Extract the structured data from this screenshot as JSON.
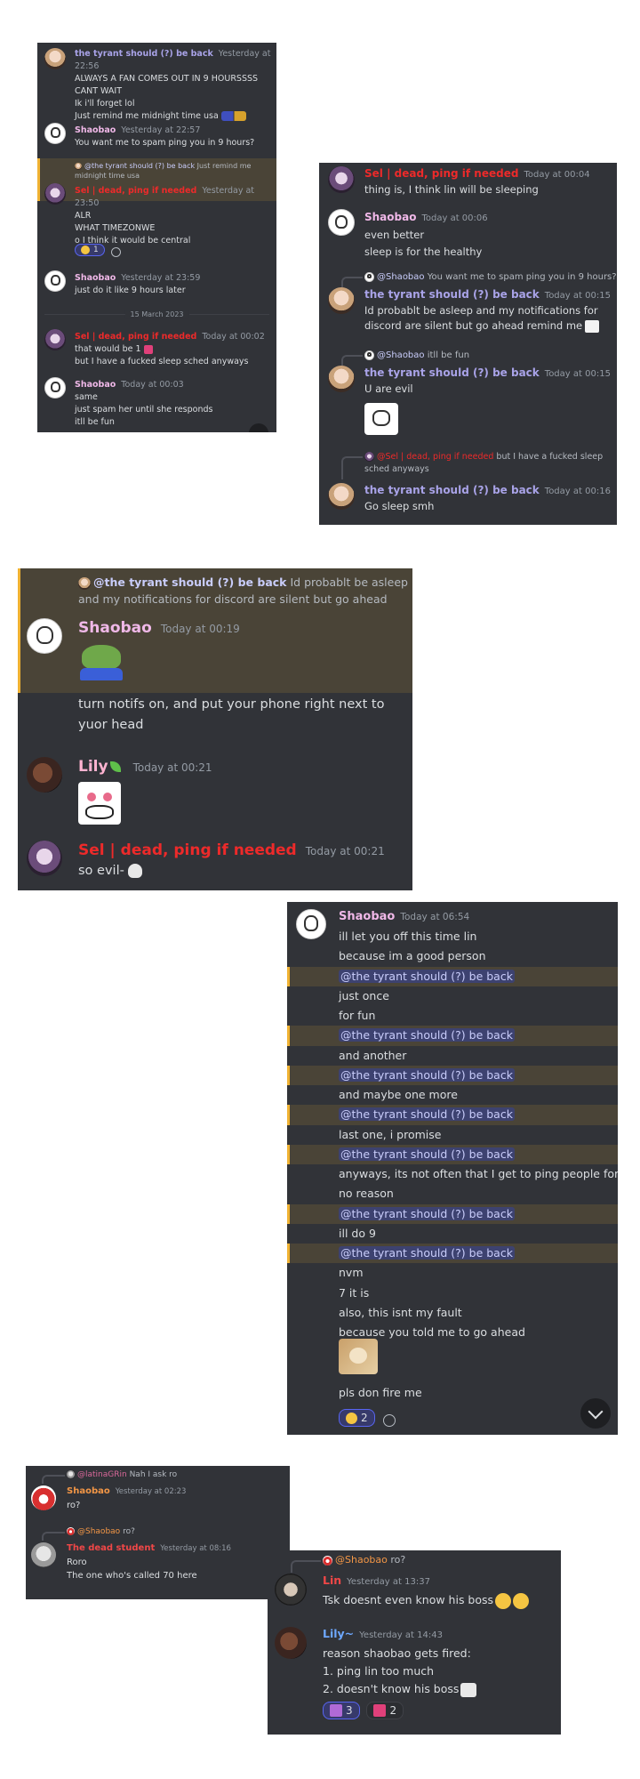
{
  "s1": {
    "m1": {
      "user": "the tyrant should (?) be back",
      "ts": "Yesterday at 22:56",
      "lines": [
        "ALWAYS A FAN COMES OUT IN 9 HOURSSSS",
        "CANT WAIT",
        "Ik i'll forget lol",
        "Just remind me midnight time usa"
      ],
      "emoji": "cheering-emoji"
    },
    "m2": {
      "user": "Shaobao",
      "ts": "Yesterday at 22:57",
      "line": "You want me to spam ping you in 9 hours?"
    },
    "m3": {
      "reply_user": "@the tyrant should (?) be back",
      "reply_text": "Just remind me",
      "reply_text2": "midnight time usa",
      "user": "Sel | dead, ping if needed",
      "ts": "Yesterday at 23:50",
      "lines": [
        "ALR",
        "WHAT TIMEZONWE",
        "o I think it would be central"
      ],
      "reaction_count": "1"
    },
    "m4": {
      "user": "Shaobao",
      "ts": "Yesterday at 23:59",
      "line": "just do it like 9 hours later"
    },
    "divider": "15 March 2023",
    "m5": {
      "user": "Sel | dead, ping if needed",
      "ts": "Today at 00:02",
      "lines": [
        "that would be 1",
        "but I have a fucked sleep sched anyways"
      ]
    },
    "m6": {
      "user": "Shaobao",
      "ts": "Today at 00:03",
      "lines": [
        "same",
        "just spam her until she responds",
        "itll be fun"
      ]
    }
  },
  "s2": {
    "m1": {
      "user": "Sel | dead, ping if needed",
      "ts": "Today at 00:04",
      "line": "thing is, I think lin will be sleeping"
    },
    "m2": {
      "user": "Shaobao",
      "ts": "Today at 00:06",
      "lines": [
        "even better",
        "sleep is for the healthy"
      ]
    },
    "m3": {
      "reply_user": "@Shaobao",
      "reply_text": "You want me to spam ping you in 9 hours?",
      "user": "the tyrant should (?) be back",
      "ts": "Today at 00:15",
      "lines": [
        "Id probablt be asleep and my notifications for",
        "discord are silent but go ahead remind me"
      ]
    },
    "m4": {
      "reply_user": "@Shaobao",
      "reply_text": "itll be fun",
      "user": "the tyrant should (?) be back",
      "ts": "Today at 00:15",
      "line": "U are evil"
    },
    "m5": {
      "reply_user": "@Sel | dead, ping if needed",
      "reply_text": "but I have a fucked sleep",
      "reply_text2": "sched anyways",
      "user": "the tyrant should (?) be back",
      "ts": "Today at 00:16",
      "line": "Go sleep smh"
    }
  },
  "s3": {
    "reply_user": "@the tyrant should (?) be back",
    "reply_text": "Id probablt be asleep",
    "reply_text2": "and my notifications for discord are silent but go ahead",
    "m1": {
      "user": "Shaobao",
      "ts": "Today at 00:19",
      "lines": [
        "turn notifs on, and put your phone right next to",
        "yuor head"
      ]
    },
    "m2": {
      "user": "Lily",
      "ts": "Today at 00:21"
    },
    "m3": {
      "user": "Sel | dead, ping if needed",
      "ts": "Today at 00:21",
      "line": "so evil-"
    }
  },
  "s4": {
    "user": "Shaobao",
    "ts": "Today at 06:54",
    "mention": "@the tyrant should (?) be back",
    "rows": [
      {
        "t": "ill let you off this time lin"
      },
      {
        "t": "because im a good person"
      },
      {
        "m": true
      },
      {
        "t": "just once"
      },
      {
        "t": "for fun"
      },
      {
        "m": true
      },
      {
        "t": "and another"
      },
      {
        "m": true
      },
      {
        "t": "and maybe one more"
      },
      {
        "m": true
      },
      {
        "t": "last one, i promise"
      },
      {
        "m": true
      },
      {
        "t": "anyways, its not often that I get to ping people for"
      },
      {
        "t": "no reason"
      },
      {
        "m": true
      },
      {
        "t": "ill do 9"
      },
      {
        "m": true
      },
      {
        "t": "nvm"
      },
      {
        "t": "7 it is"
      },
      {
        "t": "also, this isnt my fault"
      },
      {
        "t": "because you told me to go ahead"
      }
    ],
    "last_line": "pls don fire me",
    "reaction_count": "2"
  },
  "s5": {
    "reply_user": "@latinaGRin",
    "reply_text": "Nah I ask ro",
    "m1": {
      "user": "Shaobao",
      "ts": "Yesterday at 02:23",
      "line": "ro?"
    },
    "m2": {
      "reply_user": "@Shaobao",
      "reply_text": "ro?",
      "user": "The dead student",
      "ts": "Yesterday at 08:16",
      "lines": [
        "Roro",
        "The one who's called 70 here"
      ]
    }
  },
  "s6": {
    "reply_user": "@Shaobao",
    "reply_text": "ro?",
    "m1": {
      "user": "Lin",
      "ts": "Yesterday at 13:37",
      "line": "Tsk doesnt even know his boss"
    },
    "m2": {
      "user": "Lily~",
      "ts": "Yesterday at 14:43",
      "lines": [
        "reason shaobao gets fired:",
        "1. ping lin too much",
        "2. doesn't know his boss"
      ],
      "reactions": [
        "3",
        "2"
      ]
    }
  }
}
